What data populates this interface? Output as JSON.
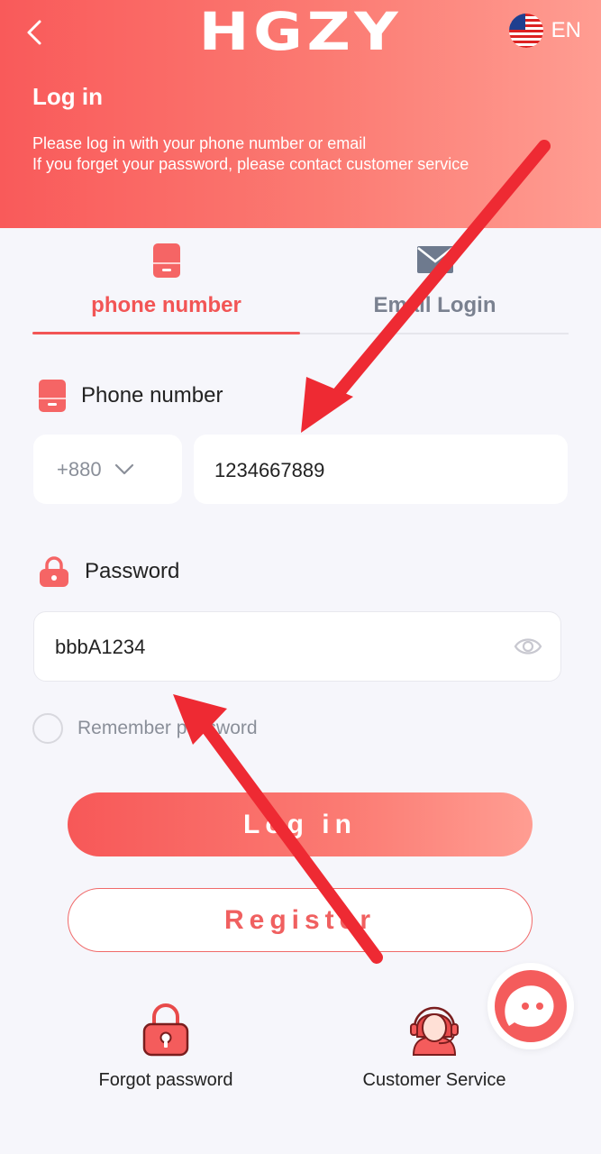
{
  "header": {
    "logo": "HGZY",
    "language": "EN",
    "title": "Log in",
    "desc_line1": "Please log in with your phone number or email",
    "desc_line2": "If you forget your password, please contact customer service"
  },
  "tabs": [
    {
      "label": "phone number",
      "active": true
    },
    {
      "label": "Email Login",
      "active": false
    }
  ],
  "phone": {
    "label": "Phone number",
    "country_code": "+880",
    "value": "1234667889"
  },
  "password": {
    "label": "Password",
    "value": "bbbA1234"
  },
  "remember": {
    "label": "Remember password",
    "checked": false
  },
  "buttons": {
    "login": "Log in",
    "register": "Register"
  },
  "bottom": {
    "forgot": "Forgot password",
    "service": "Customer Service"
  },
  "colors": {
    "accent": "#f25555",
    "annotation_arrow": "#ee2a33"
  }
}
